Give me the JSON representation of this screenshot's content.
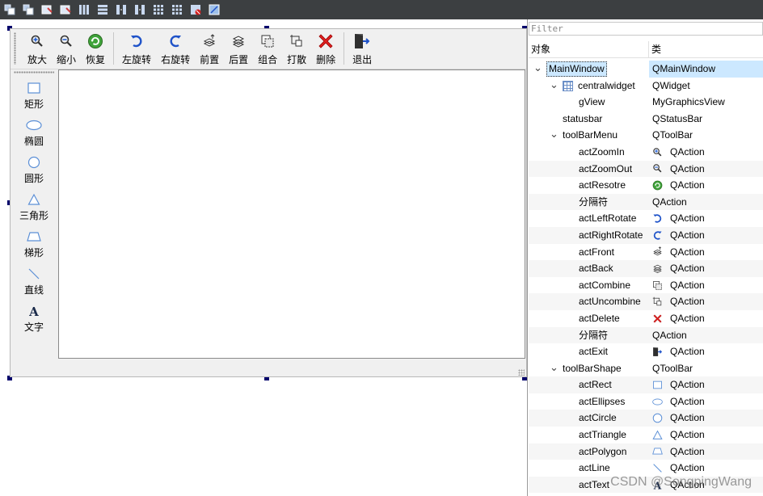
{
  "top_toolbar": {
    "icons": [
      "layout-icon",
      "layout-icon",
      "edit-icon",
      "edit-icon",
      "columns-icon",
      "rows-icon",
      "split-icon",
      "split-icon",
      "grid-icon",
      "grid-icon",
      "break-layout-icon",
      "adjust-size-icon"
    ]
  },
  "form_toolbar": {
    "items": [
      {
        "label": "放大",
        "icon": "zoom-in-icon"
      },
      {
        "label": "缩小",
        "icon": "zoom-out-icon"
      },
      {
        "label": "恢复",
        "icon": "restore-icon"
      },
      {
        "label": "左旋转",
        "icon": "rotate-left-icon"
      },
      {
        "label": "右旋转",
        "icon": "rotate-right-icon"
      },
      {
        "label": "前置",
        "icon": "bring-front-icon"
      },
      {
        "label": "后置",
        "icon": "send-back-icon"
      },
      {
        "label": "组合",
        "icon": "combine-icon"
      },
      {
        "label": "打散",
        "icon": "uncombine-icon"
      },
      {
        "label": "删除",
        "icon": "delete-icon"
      },
      {
        "label": "退出",
        "icon": "exit-icon"
      }
    ]
  },
  "shape_toolbar": {
    "items": [
      {
        "label": "矩形",
        "icon": "rectangle-icon"
      },
      {
        "label": "椭圆",
        "icon": "ellipse-icon"
      },
      {
        "label": "圆形",
        "icon": "circle-icon"
      },
      {
        "label": "三角形",
        "icon": "triangle-icon"
      },
      {
        "label": "梯形",
        "icon": "trapezoid-icon"
      },
      {
        "label": "直线",
        "icon": "line-icon"
      },
      {
        "label": "文字",
        "icon": "text-icon"
      }
    ]
  },
  "inspector": {
    "filter_placeholder": "Filter",
    "col_object": "对象",
    "col_class": "类",
    "rows": [
      {
        "name": "MainWindow",
        "cls": "QMainWindow",
        "arrow": "expanded",
        "selected": true
      },
      {
        "name": "centralwidget",
        "cls": "QWidget",
        "arrow": "expanded",
        "icon": "grid-layout-icon"
      },
      {
        "name": "gView",
        "cls": "MyGraphicsView"
      },
      {
        "name": "statusbar",
        "cls": "QStatusBar"
      },
      {
        "name": "toolBarMenu",
        "cls": "QToolBar",
        "arrow": "expanded"
      },
      {
        "name": "actZoomIn",
        "cls": "QAction",
        "icon": "zoom-in-icon"
      },
      {
        "name": "actZoomOut",
        "cls": "QAction",
        "icon": "zoom-out-icon"
      },
      {
        "name": "actResotre",
        "cls": "QAction",
        "icon": "restore-icon"
      },
      {
        "name": "分隔符",
        "cls": "QAction"
      },
      {
        "name": "actLeftRotate",
        "cls": "QAction",
        "icon": "rotate-left-icon"
      },
      {
        "name": "actRightRotate",
        "cls": "QAction",
        "icon": "rotate-right-icon"
      },
      {
        "name": "actFront",
        "cls": "QAction",
        "icon": "bring-front-icon"
      },
      {
        "name": "actBack",
        "cls": "QAction",
        "icon": "send-back-icon"
      },
      {
        "name": "actCombine",
        "cls": "QAction",
        "icon": "combine-icon"
      },
      {
        "name": "actUncombine",
        "cls": "QAction",
        "icon": "uncombine-icon"
      },
      {
        "name": "actDelete",
        "cls": "QAction",
        "icon": "delete-icon"
      },
      {
        "name": "分隔符",
        "cls": "QAction"
      },
      {
        "name": "actExit",
        "cls": "QAction",
        "icon": "exit-icon"
      },
      {
        "name": "toolBarShape",
        "cls": "QToolBar",
        "arrow": "expanded"
      },
      {
        "name": "actRect",
        "cls": "QAction",
        "icon": "rectangle-icon"
      },
      {
        "name": "actEllipses",
        "cls": "QAction",
        "icon": "ellipse-icon"
      },
      {
        "name": "actCircle",
        "cls": "QAction",
        "icon": "circle-icon"
      },
      {
        "name": "actTriangle",
        "cls": "QAction",
        "icon": "triangle-icon"
      },
      {
        "name": "actPolygon",
        "cls": "QAction",
        "icon": "trapezoid-icon"
      },
      {
        "name": "actLine",
        "cls": "QAction",
        "icon": "line-icon"
      },
      {
        "name": "actText",
        "cls": "QAction",
        "icon": "text-icon"
      }
    ]
  },
  "watermark": "CSDN @SongpingWang"
}
